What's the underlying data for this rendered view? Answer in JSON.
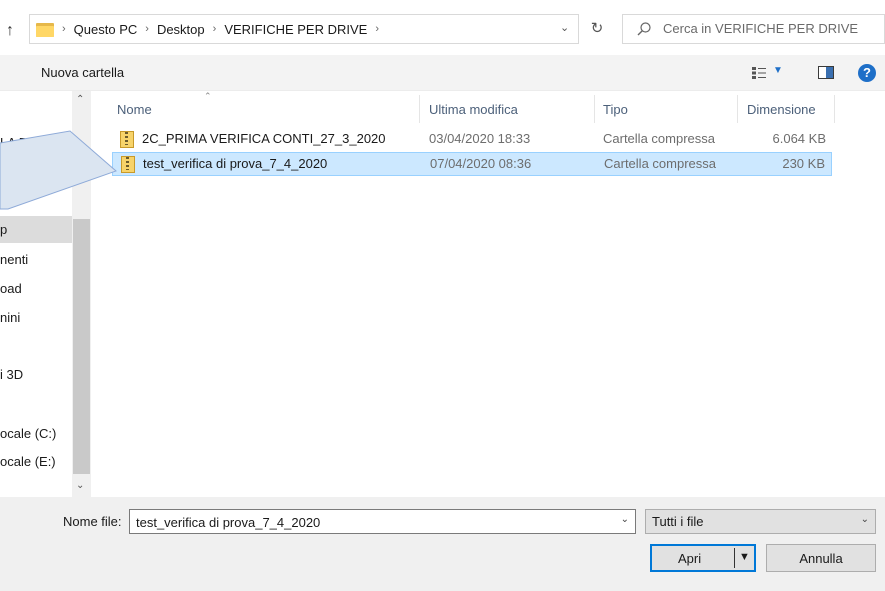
{
  "address_bar": {
    "crumbs": [
      "Questo PC",
      "Desktop",
      "VERIFICHE PER DRIVE"
    ],
    "search_placeholder": "Cerca in VERIFICHE PER DRIVE"
  },
  "toolbar": {
    "new_folder_label": "Nuova cartella"
  },
  "nav": {
    "items": [
      "LA DISTA",
      "p",
      "nenti",
      "oad",
      "nini",
      "i 3D",
      "ocale (C:)",
      "ocale (E:)"
    ]
  },
  "columns": {
    "name": "Nome",
    "modified": "Ultima modifica",
    "type": "Tipo",
    "size": "Dimensione"
  },
  "files": [
    {
      "name": "2C_PRIMA VERIFICA CONTI_27_3_2020",
      "modified": "03/04/2020 18:33",
      "type": "Cartella compressa",
      "size": "6.064 KB",
      "selected": false
    },
    {
      "name": "test_verifica di prova_7_4_2020",
      "modified": "07/04/2020 08:36",
      "type": "Cartella compressa",
      "size": "230 KB",
      "selected": true
    }
  ],
  "bottom": {
    "filename_label": "Nome file:",
    "filename_value": "test_verifica di prova_7_4_2020",
    "filetype_value": "Tutti i file",
    "open_label": "Apri",
    "cancel_label": "Annulla"
  },
  "colors": {
    "accent": "#0078d7",
    "selection_bg": "#cce8ff",
    "selection_border": "#99d1ff",
    "callout_fill": "#dbe5f1"
  }
}
